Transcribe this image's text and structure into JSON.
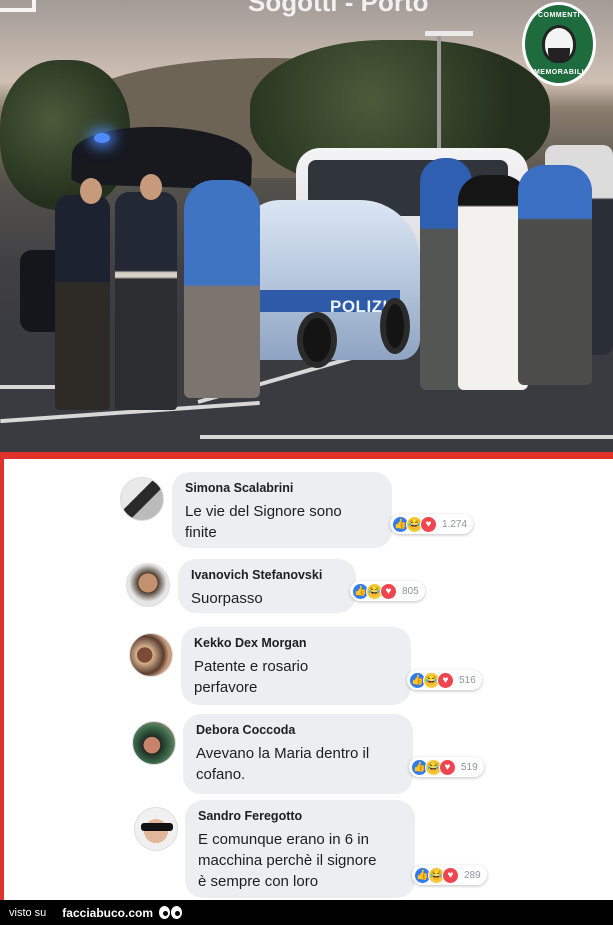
{
  "photo": {
    "overlay_text": "Sogotti - Porto",
    "car_label": "POLIZIA",
    "watermark": {
      "top_text": "COMMENTI",
      "bottom_text": "MEMORABILI"
    }
  },
  "comments": [
    {
      "name": "Simona Scalabrini",
      "text_lines": [
        "Le vie del Signore sono",
        "finite"
      ],
      "reactions": [
        "like",
        "haha",
        "love"
      ],
      "count": "1.274"
    },
    {
      "name": "Ivanovich Stefanovski",
      "text_lines": [
        "Suorpasso"
      ],
      "reactions": [
        "like",
        "haha",
        "love"
      ],
      "count": "805"
    },
    {
      "name": "Kekko Dex Morgan",
      "text_lines": [
        "Patente e rosario",
        "perfavore"
      ],
      "reactions": [
        "like",
        "haha",
        "love"
      ],
      "count": "516"
    },
    {
      "name": "Debora Coccoda",
      "text_lines": [
        "Avevano la Maria dentro il",
        "cofano."
      ],
      "reactions": [
        "like",
        "haha",
        "love"
      ],
      "count": "519"
    },
    {
      "name": "Sandro Feregotto",
      "text_lines": [
        "E comunque erano in 6 in",
        "macchina perchè il signore",
        "è sempre con loro"
      ],
      "reactions": [
        "like",
        "haha",
        "love"
      ],
      "count": "289"
    }
  ],
  "footer": {
    "prefix": "visto su",
    "site": "facciabuco.com"
  },
  "colors": {
    "divider": "#e0322b",
    "like": "#2f7bf4",
    "haha": "#f6c93a",
    "love": "#f0454f",
    "bubble": "#edeef2"
  }
}
